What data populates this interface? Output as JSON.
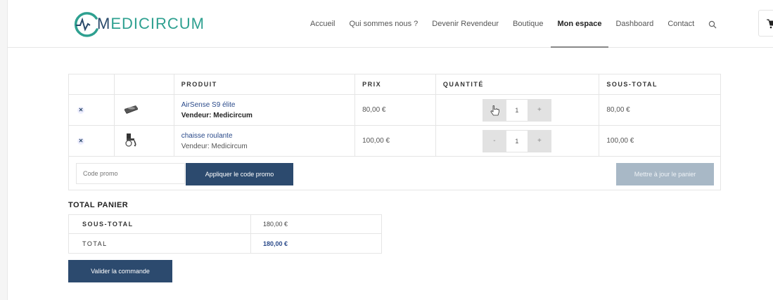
{
  "brand": {
    "logo_initial": "M",
    "logo_rest": "EDICIRCUM",
    "accent_color": "#2ea090",
    "primary_color": "#2c4a6e"
  },
  "nav": {
    "items": [
      {
        "label": "Accueil",
        "active": false
      },
      {
        "label": "Qui sommes nous ?",
        "active": false
      },
      {
        "label": "Devenir Revendeur",
        "active": false
      },
      {
        "label": "Boutique",
        "active": false
      },
      {
        "label": "Mon espace",
        "active": true
      },
      {
        "label": "Dashboard",
        "active": false
      },
      {
        "label": "Contact",
        "active": false
      }
    ],
    "search_icon": "search-icon",
    "cart_icon": "cart-icon"
  },
  "cart": {
    "headers": {
      "product": "PRODUIT",
      "price": "PRIX",
      "quantity": "QUANTITÉ",
      "subtotal": "SOUS-TOTAL"
    },
    "items": [
      {
        "name": "AirSense S9 élite",
        "vendor_label": "Vendeur:",
        "vendor": "Medicircum",
        "price": "80,00 €",
        "qty_minus": "-",
        "qty": "1",
        "qty_plus": "+",
        "subtotal": "80,00 €",
        "thumb_icon": "cpap-device-icon"
      },
      {
        "name": "chaisse roulante",
        "vendor_label": "Vendeur:",
        "vendor": "Medicircum",
        "price": "100,00 €",
        "qty_minus": "-",
        "qty": "1",
        "qty_plus": "+",
        "subtotal": "100,00 €",
        "thumb_icon": "wheelchair-icon"
      }
    ],
    "coupon_placeholder": "Code promo",
    "apply_label": "Appliquer le code promo",
    "update_label": "Mettre à jour le panier"
  },
  "totals": {
    "title": "TOTAL PANIER",
    "subtotal_label": "SOUS-TOTAL",
    "subtotal_value": "180,00 €",
    "total_label": "TOTAL",
    "total_value": "180,00 €",
    "checkout_label": "Valider la commande"
  }
}
